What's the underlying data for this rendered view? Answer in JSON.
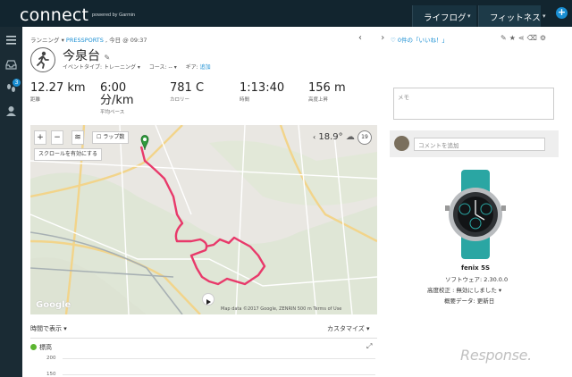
{
  "app": {
    "logo": "connect",
    "logo_sub": "powered by Garmin",
    "tabs": [
      "ライフログ",
      "フィットネス"
    ]
  },
  "sidebar": {
    "badge_count": "3"
  },
  "activity": {
    "breadcrumb_type": "ランニング",
    "breadcrumb_source": "PRESSPORTS",
    "breadcrumb_time": "今日 @ 09:37",
    "likes": "0件の「いいね！」",
    "name": "今泉台",
    "event_label": "イベントタイプ:",
    "event_value": "トレーニング",
    "course_label": "コース:",
    "course_value": "--",
    "gear_label": "ギア:",
    "gear_value": "追加"
  },
  "stats": [
    {
      "value": "12.27 km",
      "label": "距離"
    },
    {
      "value": "6:00 分/km",
      "label": "平均ペース"
    },
    {
      "value": "781 C",
      "label": "カロリー"
    },
    {
      "value": "1:13:40",
      "label": "時間"
    },
    {
      "value": "156 m",
      "label": "高度上昇"
    }
  ],
  "map": {
    "lap_toggle": "ラップ数",
    "scroll_button": "スクロールを有効にする",
    "temperature": "18.9°",
    "wind": "19",
    "credit": "Map data ©2017 Google, ZENRIN   500 m          Terms of Use",
    "google": "Google"
  },
  "memo": {
    "placeholder": "メモ"
  },
  "comment": {
    "placeholder": "コメントを追加"
  },
  "device": {
    "name": "fenix 5S",
    "software": "ソフトウェア: 2.30.0.0",
    "altitude": "高度校正 : 無効にしました",
    "summary": "概要データ: 更新日"
  },
  "bottom": {
    "time_view": "時間で表示",
    "customize": "カスタマイズ",
    "elevation": "標高",
    "y_ticks": [
      "200",
      "150"
    ]
  },
  "watermark": "Response."
}
